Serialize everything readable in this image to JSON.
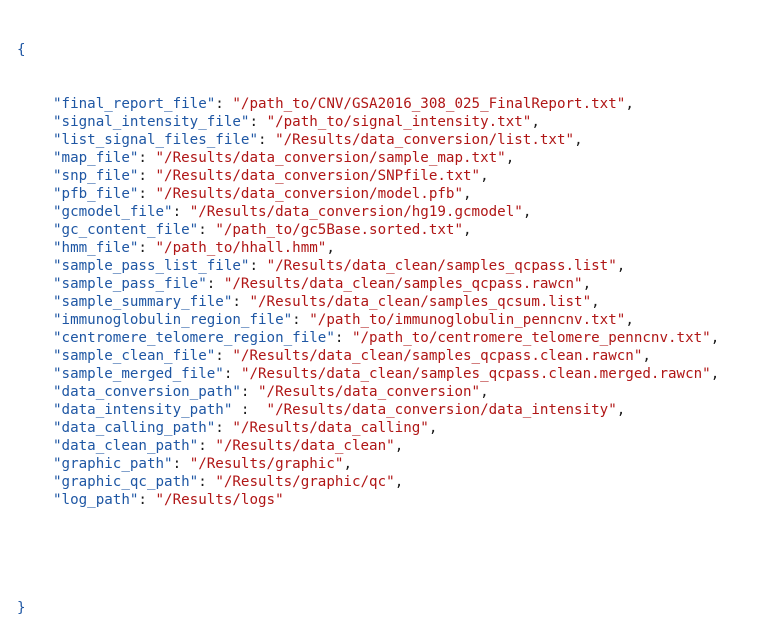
{
  "open_brace": "{",
  "close_brace": "}",
  "entries": [
    {
      "key": "\"final_report_file\"",
      "sep": ": ",
      "value": "\"/path_to/CNV/GSA2016_308_025_FinalReport.txt\"",
      "end": ","
    },
    {
      "key": "\"signal_intensity_file\"",
      "sep": ": ",
      "value": "\"/path_to/signal_intensity.txt\"",
      "end": ","
    },
    {
      "key": "\"list_signal_files_file\"",
      "sep": ": ",
      "value": "\"/Results/data_conversion/list.txt\"",
      "end": ","
    },
    {
      "key": "\"map_file\"",
      "sep": ": ",
      "value": "\"/Results/data_conversion/sample_map.txt\"",
      "end": ","
    },
    {
      "key": "\"snp_file\"",
      "sep": ": ",
      "value": "\"/Results/data_conversion/SNPfile.txt\"",
      "end": ","
    },
    {
      "key": "\"pfb_file\"",
      "sep": ": ",
      "value": "\"/Results/data_conversion/model.pfb\"",
      "end": ","
    },
    {
      "key": "\"gcmodel_file\"",
      "sep": ": ",
      "value": "\"/Results/data_conversion/hg19.gcmodel\"",
      "end": ","
    },
    {
      "key": "\"gc_content_file\"",
      "sep": ": ",
      "value": "\"/path_to/gc5Base.sorted.txt\"",
      "end": ","
    },
    {
      "key": "\"hmm_file\"",
      "sep": ": ",
      "value": "\"/path_to/hhall.hmm\"",
      "end": ","
    },
    {
      "key": "\"sample_pass_list_file\"",
      "sep": ": ",
      "value": "\"/Results/data_clean/samples_qcpass.list\"",
      "end": ","
    },
    {
      "key": "\"sample_pass_file\"",
      "sep": ": ",
      "value": "\"/Results/data_clean/samples_qcpass.rawcn\"",
      "end": ","
    },
    {
      "key": "\"sample_summary_file\"",
      "sep": ": ",
      "value": "\"/Results/data_clean/samples_qcsum.list\"",
      "end": ","
    },
    {
      "key": "\"immunoglobulin_region_file\"",
      "sep": ": ",
      "value": "\"/path_to/immunoglobulin_penncnv.txt\"",
      "end": ","
    },
    {
      "key": "\"centromere_telomere_region_file\"",
      "sep": ": ",
      "value": "\"/path_to/centromere_telomere_penncnv.txt\"",
      "end": ","
    },
    {
      "key": "\"sample_clean_file\"",
      "sep": ": ",
      "value": "\"/Results/data_clean/samples_qcpass.clean.rawcn\"",
      "end": ","
    },
    {
      "key": "\"sample_merged_file\"",
      "sep": ": ",
      "value": "\"/Results/data_clean/samples_qcpass.clean.merged.rawcn\"",
      "end": ","
    },
    {
      "key": "\"data_conversion_path\"",
      "sep": ": ",
      "value": "\"/Results/data_conversion\"",
      "end": ","
    },
    {
      "key": "\"data_intensity_path\"",
      "sep": " :  ",
      "value": "\"/Results/data_conversion/data_intensity\"",
      "end": ","
    },
    {
      "key": "\"data_calling_path\"",
      "sep": ": ",
      "value": "\"/Results/data_calling\"",
      "end": ","
    },
    {
      "key": "\"data_clean_path\"",
      "sep": ": ",
      "value": "\"/Results/data_clean\"",
      "end": ","
    },
    {
      "key": "\"graphic_path\"",
      "sep": ": ",
      "value": "\"/Results/graphic\"",
      "end": ","
    },
    {
      "key": "\"graphic_qc_path\"",
      "sep": ": ",
      "value": "\"/Results/graphic/qc\"",
      "end": ","
    },
    {
      "key": "\"log_path\"",
      "sep": ": ",
      "value": "\"/Results/logs\"",
      "end": ""
    }
  ]
}
